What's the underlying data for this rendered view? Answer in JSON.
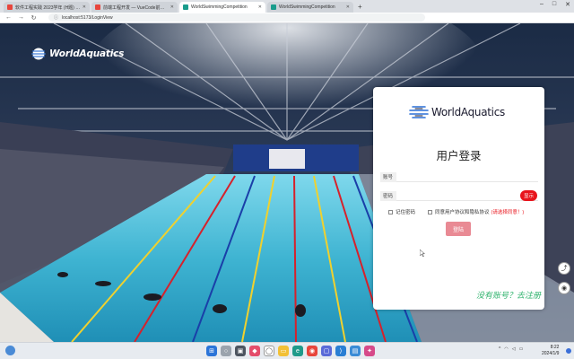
{
  "browser": {
    "tabs": [
      {
        "label": "软件工程实践 2023学年 (H题) …",
        "favicon_color": "#e8453c"
      },
      {
        "label": "前端工程开发 — VueCode前端项目…",
        "favicon_color": "#e8453c"
      },
      {
        "label": "WorldSwimmingCompetition",
        "favicon_color": "#1a9c8c",
        "active": true
      },
      {
        "label": "WorldSwimmingCompetition",
        "favicon_color": "#1a9c8c"
      }
    ],
    "url": "localhost:5173/LoginView"
  },
  "header": {
    "brand": "WorldAquatics"
  },
  "login": {
    "logo_text": "WorldAquatics",
    "title": "用户登录",
    "username_label": "账号",
    "username_value": "",
    "password_label": "密码",
    "password_value": "",
    "show_password_label": "显示",
    "remember_label": "记住密码",
    "agree_label": "同意用户协议和隐私协议",
    "agree_warning": "(请选择同意！)",
    "login_button": "登陆",
    "register_link": "没有账号？去注册"
  },
  "colors": {
    "brand_red": "#e8141c",
    "login_button": "#e98a94",
    "register_green": "#2fb36d"
  },
  "taskbar": {
    "clock_time": "8:22",
    "clock_date": "2024/1/9"
  }
}
